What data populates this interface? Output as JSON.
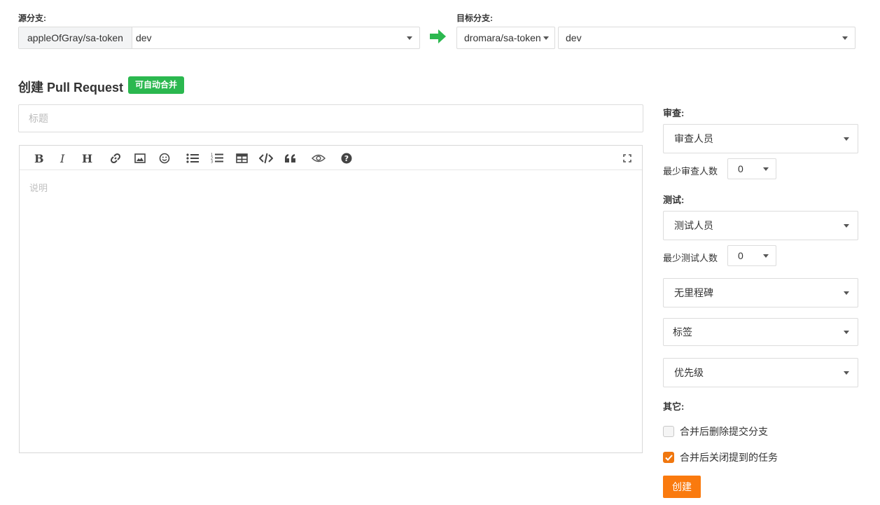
{
  "source": {
    "label": "源分支:",
    "repo": "appleOfGray/sa-token",
    "branch": "dev"
  },
  "target": {
    "label": "目标分支:",
    "repo": "dromara/sa-token",
    "branch": "dev"
  },
  "header": {
    "title": "创建 Pull Request",
    "badge": "可自动合并"
  },
  "form": {
    "title_placeholder": "标题",
    "description_placeholder": "说明"
  },
  "toolbar": {
    "icons": [
      "bold-icon",
      "italic-icon",
      "heading-icon",
      "link-icon",
      "image-icon",
      "emoji-icon",
      "unordered-list-icon",
      "ordered-list-icon",
      "table-icon",
      "code-icon",
      "quote-icon",
      "preview-eye-icon",
      "help-icon",
      "fullscreen-icon"
    ]
  },
  "sidebar": {
    "review_label": "审查:",
    "reviewers": "审查人员",
    "min_reviewers_label": "最少审查人数",
    "min_reviewers_value": "0",
    "test_label": "测试:",
    "testers": "测试人员",
    "min_testers_label": "最少测试人数",
    "min_testers_value": "0",
    "milestone": "无里程碑",
    "labels": "标签",
    "priority": "优先级",
    "other_label": "其它:",
    "delete_branch_label": "合并后删除提交分支",
    "delete_branch_checked": false,
    "close_issues_label": "合并后关闭提到的任务",
    "close_issues_checked": true,
    "create_button": "创建"
  },
  "colors": {
    "badge_green": "#2bb84f",
    "arrow_green": "#2bb84f",
    "accent_orange": "#fa7a0e",
    "checkbox_orange": "#f0770f"
  }
}
